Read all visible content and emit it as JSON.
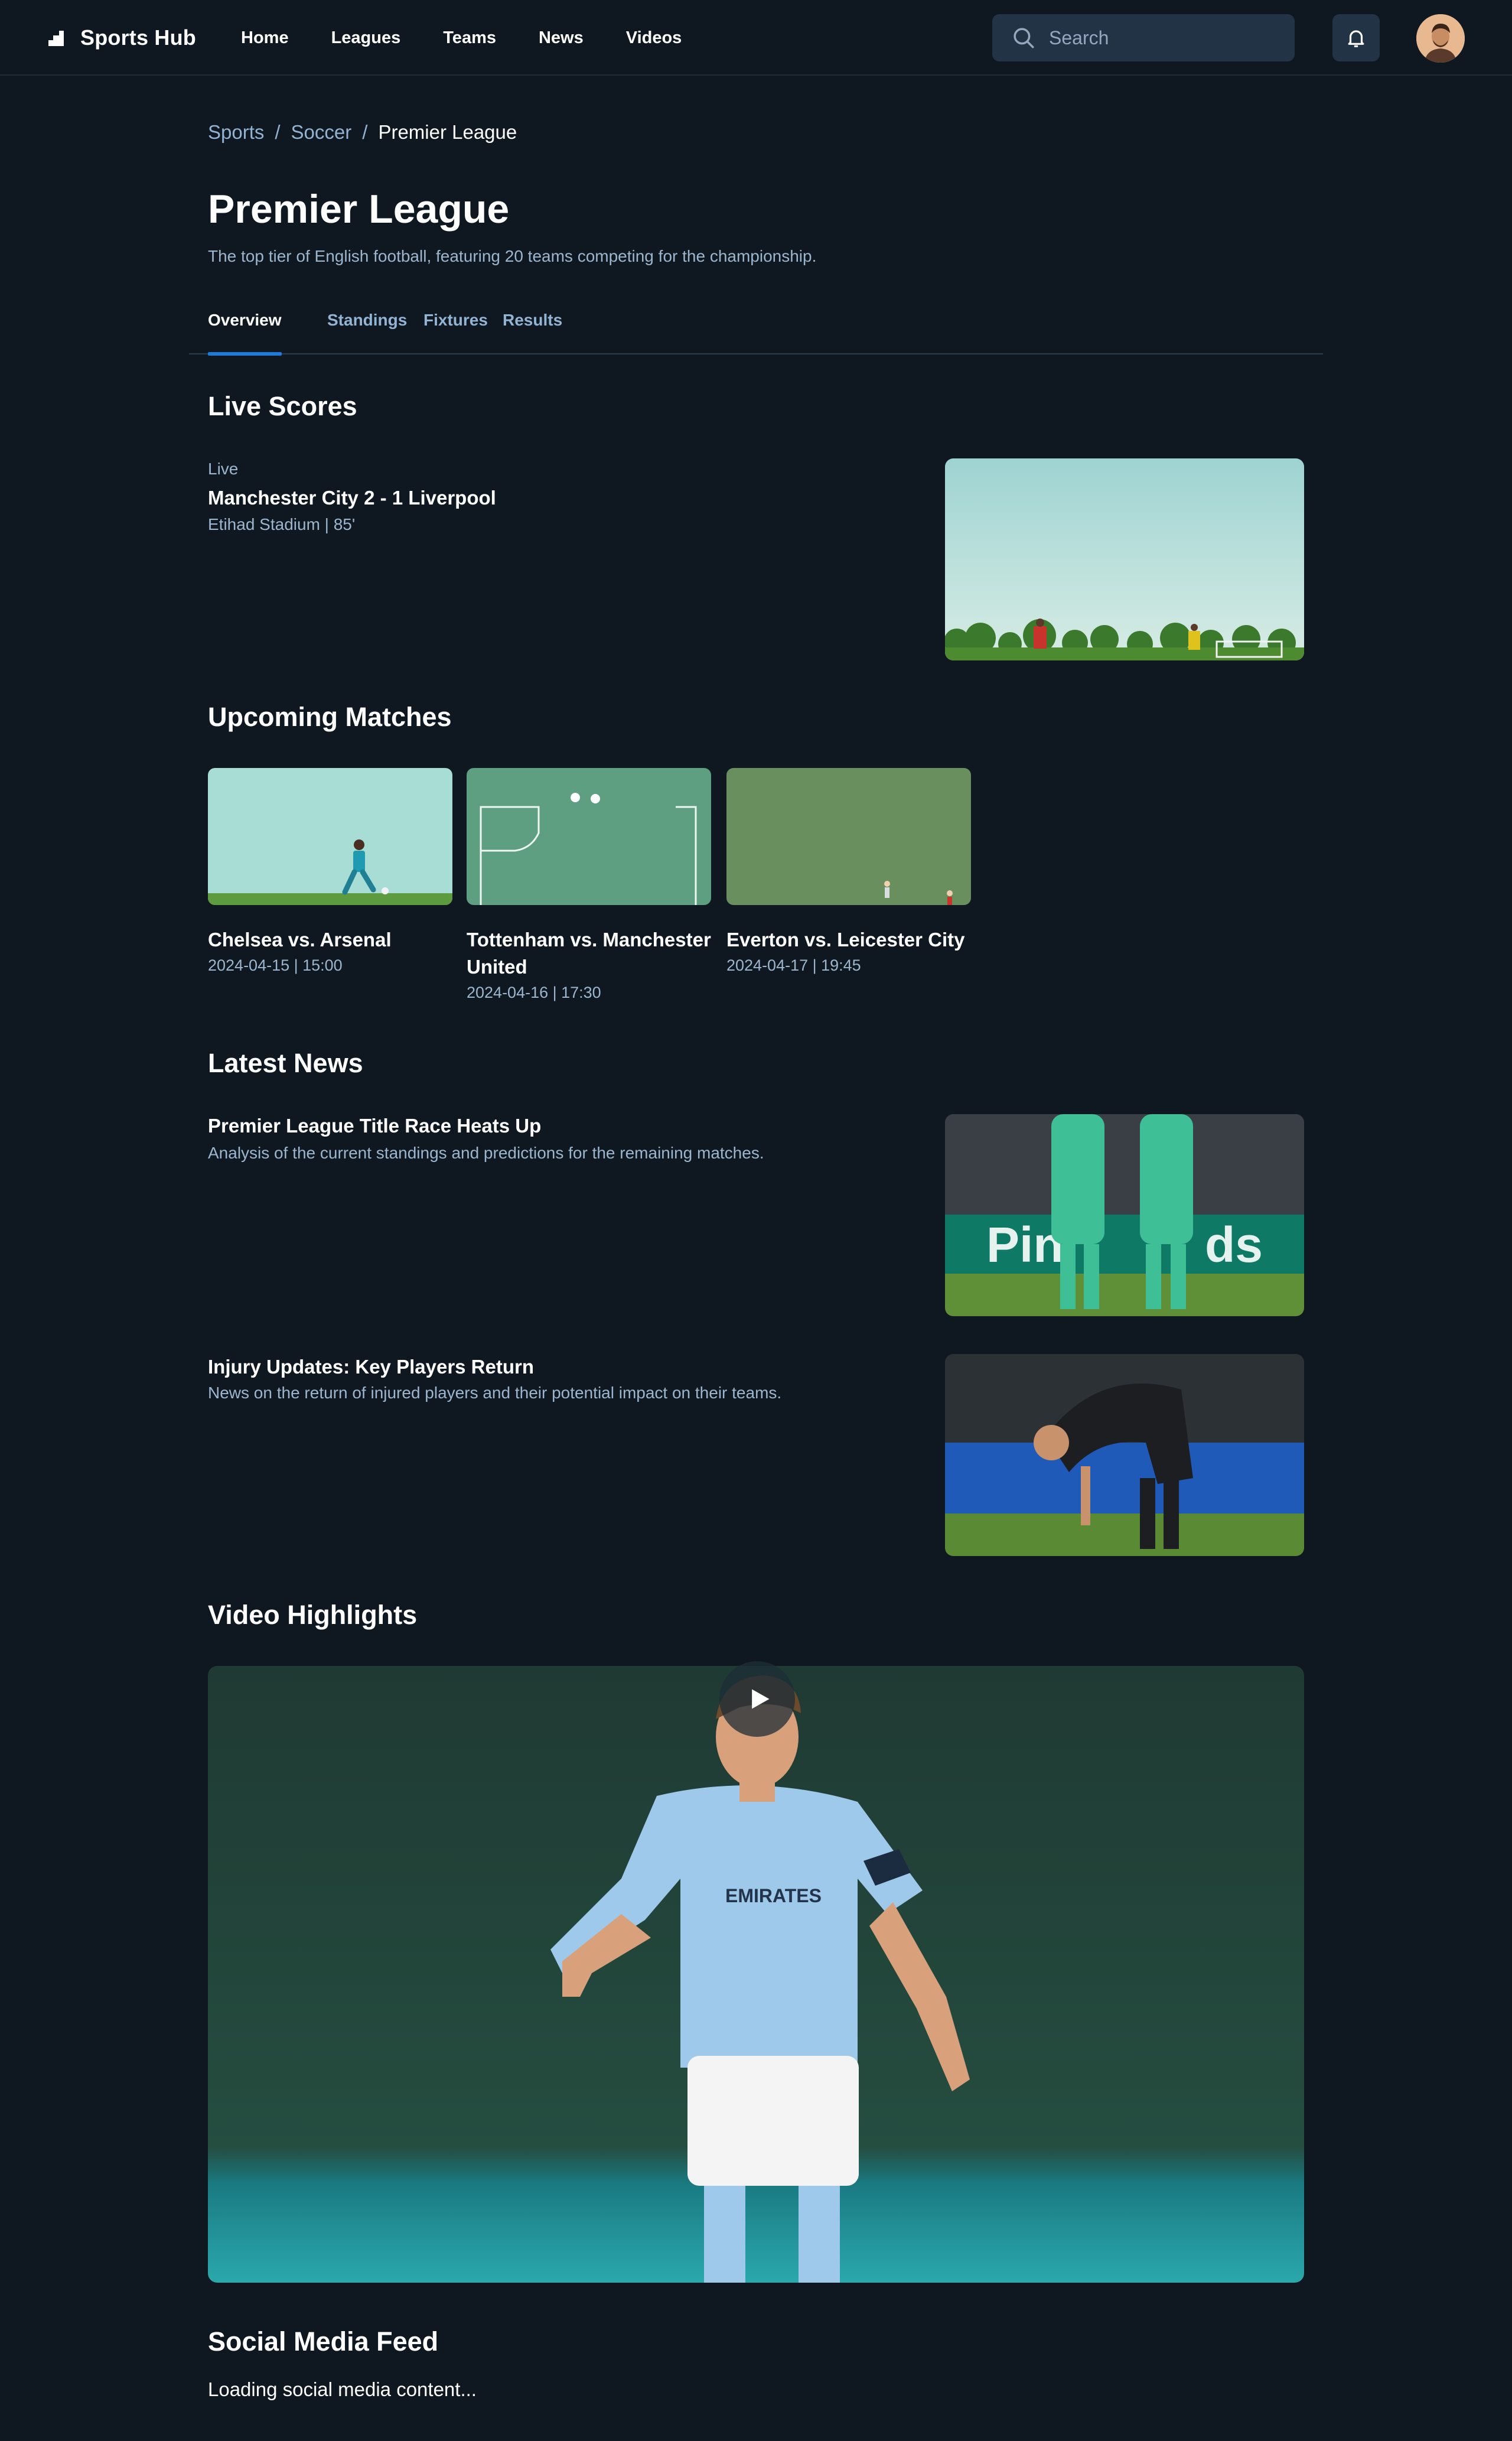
{
  "header": {
    "brand": "Sports Hub",
    "nav": [
      "Home",
      "Leagues",
      "Teams",
      "News",
      "Videos"
    ],
    "search_placeholder": "Search"
  },
  "breadcrumb": {
    "items": [
      "Sports",
      "Soccer"
    ],
    "separator": "/",
    "current": "Premier League"
  },
  "page": {
    "title": "Premier League",
    "subtitle": "The top tier of English football, featuring 20 teams competing for the championship."
  },
  "tabs": [
    "Overview",
    "Standings",
    "Fixtures",
    "Results"
  ],
  "active_tab": "Overview",
  "live_scores": {
    "heading": "Live Scores",
    "status": "Live",
    "match": "Manchester City 2 - 1 Liverpool",
    "venue": "Etihad Stadium | 85'"
  },
  "upcoming": {
    "heading": "Upcoming Matches",
    "matches": [
      {
        "title": "Chelsea vs. Arsenal",
        "time": "2024-04-15 | 15:00"
      },
      {
        "title": "Tottenham vs. Manchester United",
        "time": "2024-04-16 | 17:30"
      },
      {
        "title": "Everton vs. Leicester City",
        "time": "2024-04-17 | 19:45"
      }
    ]
  },
  "news": {
    "heading": "Latest News",
    "articles": [
      {
        "title": "Premier League Title Race Heats Up",
        "desc": "Analysis of the current standings and predictions for the remaining matches."
      },
      {
        "title": "Injury Updates: Key Players Return",
        "desc": "News on the return of injured players and their potential impact on their teams."
      }
    ]
  },
  "video": {
    "heading": "Video Highlights"
  },
  "social": {
    "heading": "Social Media Feed",
    "loading": "Loading social media content..."
  },
  "colors": {
    "background": "#0f1820",
    "surface": "#223345",
    "muted_text": "#9db6cf",
    "link": "#93b3d3",
    "accent": "#1f7bd8"
  },
  "icons": [
    "logo-icon",
    "search-icon",
    "bell-icon",
    "avatar",
    "play-icon"
  ]
}
